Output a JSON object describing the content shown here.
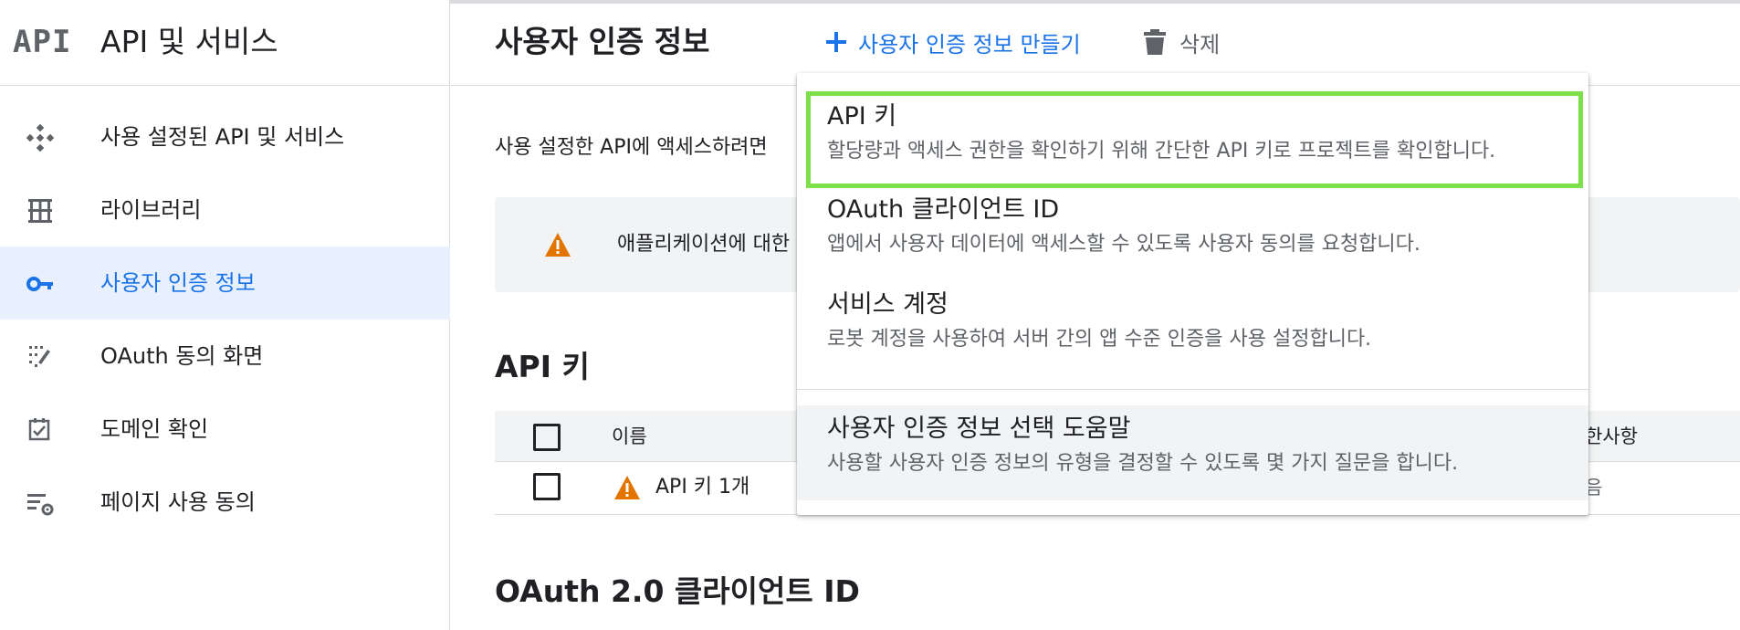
{
  "sidebar": {
    "logo": "API",
    "title": "API 및 서비스",
    "items": [
      {
        "label": "사용 설정된 API 및 서비스",
        "icon": "api-diamond-icon"
      },
      {
        "label": "라이브러리",
        "icon": "library-icon"
      },
      {
        "label": "사용자 인증 정보",
        "icon": "key-icon",
        "active": true
      },
      {
        "label": "OAuth 동의 화면",
        "icon": "consent-screen-icon"
      },
      {
        "label": "도메인 확인",
        "icon": "checkbox-icon"
      },
      {
        "label": "페이지 사용 동의",
        "icon": "settings-list-icon"
      }
    ]
  },
  "header": {
    "title": "사용자 인증 정보",
    "create_label": "사용자 인증 정보 만들기",
    "delete_label": "삭제"
  },
  "main": {
    "intro": "사용 설정한 API에 액세스하려면",
    "notice": "애플리케이션에 대한",
    "api_keys": {
      "heading": "API 키",
      "columns": {
        "name": "이름",
        "restrictions": "한사항"
      },
      "rows": [
        {
          "name": "API 키 1개",
          "restrictions": "음"
        }
      ]
    },
    "oauth_heading": "OAuth 2.0 클라이언트 ID"
  },
  "menu": {
    "items": [
      {
        "title": "API 키",
        "description": "할당량과 액세스 권한을 확인하기 위해 간단한 API 키로 프로젝트를 확인합니다."
      },
      {
        "title": "OAuth 클라이언트 ID",
        "description": "앱에서 사용자 데이터에 액세스할 수 있도록 사용자 동의를 요청합니다."
      },
      {
        "title": "서비스 계정",
        "description": "로봇 계정을 사용하여 서버 간의 앱 수준 인증을 사용 설정합니다."
      },
      {
        "title": "사용자 인증 정보 선택 도움말",
        "description": "사용할 사용자 인증 정보의 유형을 결정할 수 있도록 몇 가지 질문을 합니다."
      }
    ]
  },
  "colors": {
    "accent": "#1a73e8",
    "highlight": "#7be04a",
    "warning": "#e37400",
    "active_bg": "#e8f0fe"
  }
}
